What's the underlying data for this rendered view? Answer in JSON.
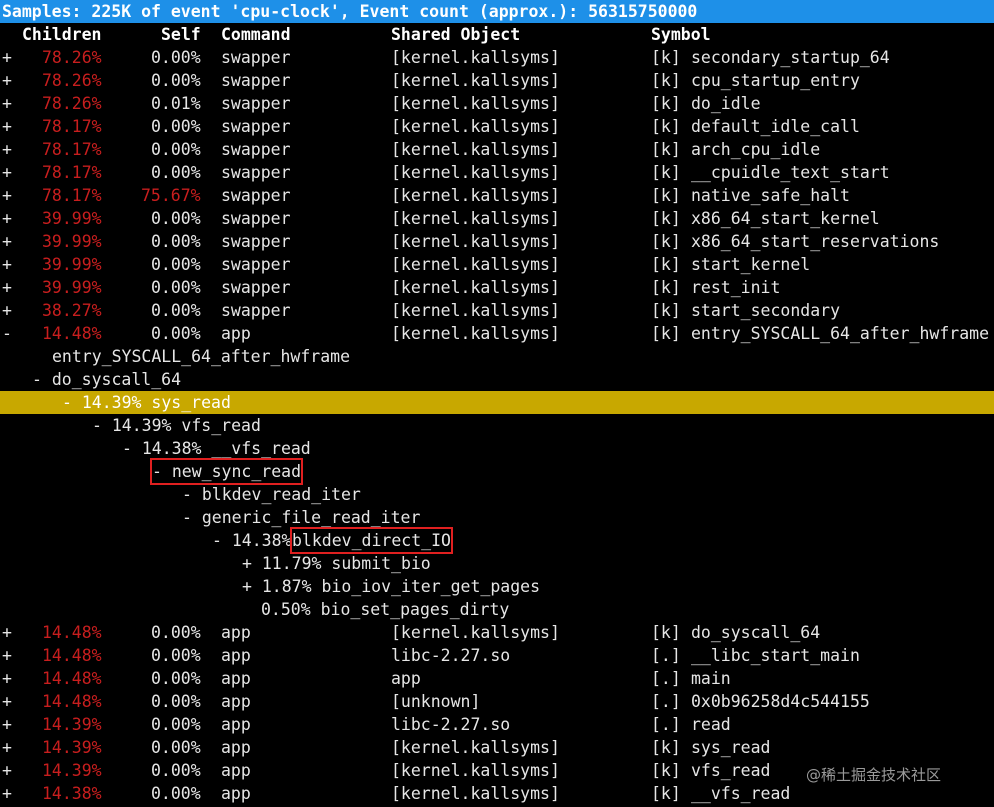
{
  "title": "Samples: 225K of event 'cpu-clock', Event count (approx.): 56315750000",
  "headers": {
    "children": "Children",
    "self": "Self",
    "command": "Command",
    "shared_object": "Shared Object",
    "symbol": "Symbol"
  },
  "colors": {
    "title_bg": "#1e90e8",
    "highlight_bg": "#c8a800",
    "overhead_red": "#c81e1e",
    "box": "#e02020"
  },
  "top_rows": [
    {
      "toggle": "+",
      "children": "78.26%",
      "self": "0.00%",
      "command": "swapper",
      "dso": "[kernel.kallsyms]",
      "kind": "[k]",
      "symbol": "secondary_startup_64"
    },
    {
      "toggle": "+",
      "children": "78.26%",
      "self": "0.00%",
      "command": "swapper",
      "dso": "[kernel.kallsyms]",
      "kind": "[k]",
      "symbol": "cpu_startup_entry"
    },
    {
      "toggle": "+",
      "children": "78.26%",
      "self": "0.01%",
      "command": "swapper",
      "dso": "[kernel.kallsyms]",
      "kind": "[k]",
      "symbol": "do_idle"
    },
    {
      "toggle": "+",
      "children": "78.17%",
      "self": "0.00%",
      "command": "swapper",
      "dso": "[kernel.kallsyms]",
      "kind": "[k]",
      "symbol": "default_idle_call"
    },
    {
      "toggle": "+",
      "children": "78.17%",
      "self": "0.00%",
      "command": "swapper",
      "dso": "[kernel.kallsyms]",
      "kind": "[k]",
      "symbol": "arch_cpu_idle"
    },
    {
      "toggle": "+",
      "children": "78.17%",
      "self": "0.00%",
      "command": "swapper",
      "dso": "[kernel.kallsyms]",
      "kind": "[k]",
      "symbol": "__cpuidle_text_start"
    },
    {
      "toggle": "+",
      "children": "78.17%",
      "self": "75.67%",
      "command": "swapper",
      "dso": "[kernel.kallsyms]",
      "kind": "[k]",
      "symbol": "native_safe_halt",
      "self_red": true
    },
    {
      "toggle": "+",
      "children": "39.99%",
      "self": "0.00%",
      "command": "swapper",
      "dso": "[kernel.kallsyms]",
      "kind": "[k]",
      "symbol": "x86_64_start_kernel"
    },
    {
      "toggle": "+",
      "children": "39.99%",
      "self": "0.00%",
      "command": "swapper",
      "dso": "[kernel.kallsyms]",
      "kind": "[k]",
      "symbol": "x86_64_start_reservations"
    },
    {
      "toggle": "+",
      "children": "39.99%",
      "self": "0.00%",
      "command": "swapper",
      "dso": "[kernel.kallsyms]",
      "kind": "[k]",
      "symbol": "start_kernel"
    },
    {
      "toggle": "+",
      "children": "39.99%",
      "self": "0.00%",
      "command": "swapper",
      "dso": "[kernel.kallsyms]",
      "kind": "[k]",
      "symbol": "rest_init"
    },
    {
      "toggle": "+",
      "children": "38.27%",
      "self": "0.00%",
      "command": "swapper",
      "dso": "[kernel.kallsyms]",
      "kind": "[k]",
      "symbol": "start_secondary"
    },
    {
      "toggle": "-",
      "children": "14.48%",
      "self": "0.00%",
      "command": "app",
      "dso": "[kernel.kallsyms]",
      "kind": "[k]",
      "symbol": "entry_SYSCALL_64_after_hwframe"
    }
  ],
  "tree": [
    {
      "text": "entry_SYSCALL_64_after_hwframe"
    },
    {
      "text": "- do_syscall_64"
    },
    {
      "text": "- 14.39% sys_read",
      "highlight": true
    },
    {
      "text": "- 14.39% vfs_read"
    },
    {
      "text": "- 14.38% __vfs_read"
    },
    {
      "text": "- new_sync_read",
      "boxed": true
    },
    {
      "text": "- blkdev_read_iter"
    },
    {
      "text": "- generic_file_read_iter"
    },
    {
      "text": "- 14.38% ",
      "boxed_suffix": "blkdev_direct_IO"
    },
    {
      "text": "+ 11.79% submit_bio"
    },
    {
      "text": "+ 1.87% bio_iov_iter_get_pages"
    },
    {
      "text": "0.50% bio_set_pages_dirty"
    }
  ],
  "bottom_rows": [
    {
      "toggle": "+",
      "children": "14.48%",
      "self": "0.00%",
      "command": "app",
      "dso": "[kernel.kallsyms]",
      "kind": "[k]",
      "symbol": "do_syscall_64"
    },
    {
      "toggle": "+",
      "children": "14.48%",
      "self": "0.00%",
      "command": "app",
      "dso": "libc-2.27.so",
      "kind": "[.]",
      "symbol": "__libc_start_main"
    },
    {
      "toggle": "+",
      "children": "14.48%",
      "self": "0.00%",
      "command": "app",
      "dso": "app",
      "kind": "[.]",
      "symbol": "main"
    },
    {
      "toggle": "+",
      "children": "14.48%",
      "self": "0.00%",
      "command": "app",
      "dso": "[unknown]",
      "kind": "[.]",
      "symbol": "0x0b96258d4c544155"
    },
    {
      "toggle": "+",
      "children": "14.39%",
      "self": "0.00%",
      "command": "app",
      "dso": "libc-2.27.so",
      "kind": "[.]",
      "symbol": "read"
    },
    {
      "toggle": "+",
      "children": "14.39%",
      "self": "0.00%",
      "command": "app",
      "dso": "[kernel.kallsyms]",
      "kind": "[k]",
      "symbol": "sys_read"
    },
    {
      "toggle": "+",
      "children": "14.39%",
      "self": "0.00%",
      "command": "app",
      "dso": "[kernel.kallsyms]",
      "kind": "[k]",
      "symbol": "vfs_read"
    },
    {
      "toggle": "+",
      "children": "14.38%",
      "self": "0.00%",
      "command": "app",
      "dso": "[kernel.kallsyms]",
      "kind": "[k]",
      "symbol": "__vfs_read"
    }
  ],
  "watermark": "@稀土掘金技术社区"
}
